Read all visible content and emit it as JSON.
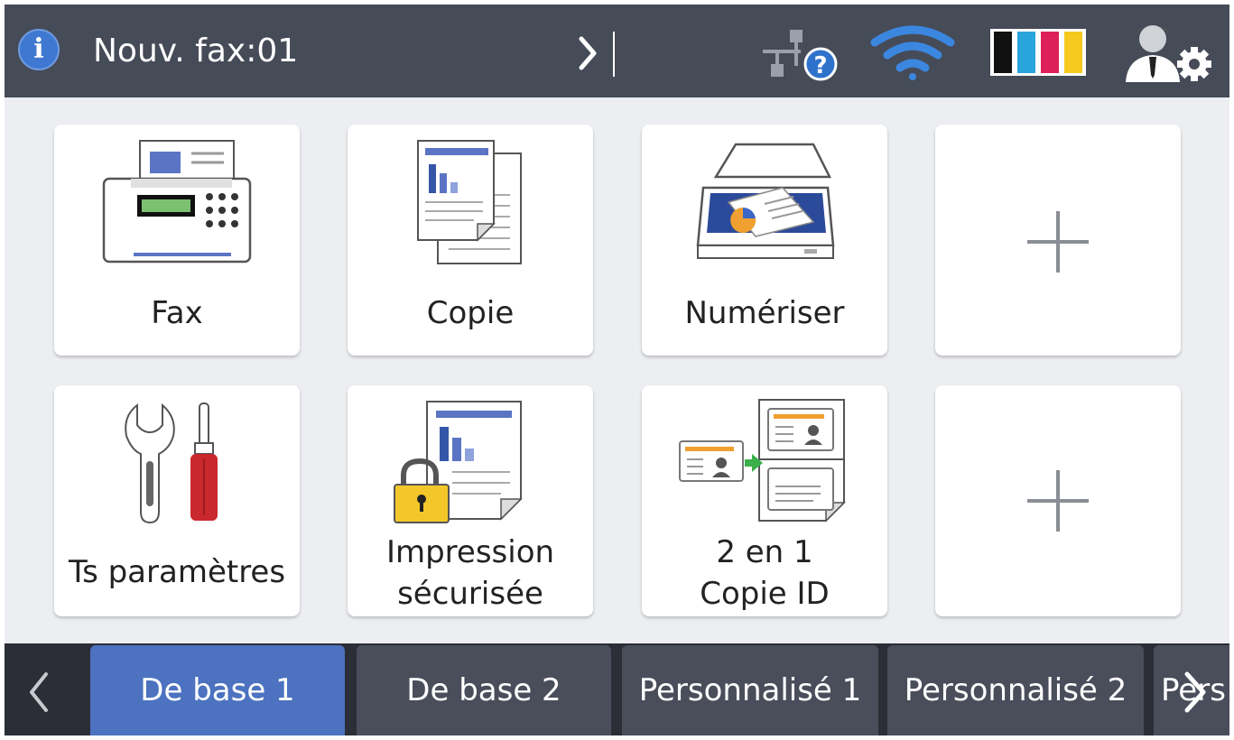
{
  "status_bar": {
    "info_icon": "info-icon",
    "info_glyph": "i",
    "message": "Nouv. fax:01",
    "message_arrow_icon": "chevron-right-icon",
    "network_icon": "wired-network-unknown-icon",
    "wifi_icon": "wifi-icon",
    "ink_icon": "ink-levels-icon",
    "admin_icon": "admin-settings-icon",
    "ink_colors": [
      "#111111",
      "#2aa5dc",
      "#dd1f5a",
      "#f6c91e"
    ]
  },
  "grid": {
    "tiles": [
      {
        "label": "Fax",
        "icon": "fax-machine-icon"
      },
      {
        "label": "Copie",
        "icon": "copy-document-icon"
      },
      {
        "label": "Numériser",
        "icon": "scanner-icon"
      },
      {
        "label": "",
        "icon": "plus-icon"
      },
      {
        "label": "Ts paramètres",
        "icon": "tools-icon"
      },
      {
        "label_line1": "Impression",
        "label_line2": "sécurisée",
        "icon": "secure-print-lock-icon"
      },
      {
        "label_line1": "2 en 1",
        "label_line2": "Copie ID",
        "icon": "id-card-copy-icon"
      },
      {
        "label": "",
        "icon": "plus-icon"
      }
    ]
  },
  "tabs": {
    "prev_icon": "chevron-left-icon",
    "next_icon": "chevron-right-icon",
    "items": [
      {
        "label": "De base 1",
        "active": true
      },
      {
        "label": "De base 2",
        "active": false
      },
      {
        "label": "Personnalisé 1",
        "active": false
      },
      {
        "label": "Personnalisé 2",
        "active": false
      },
      {
        "label": "Pers",
        "active": false
      }
    ]
  },
  "colors": {
    "header_bg": "#464b58",
    "screen_bg": "#eceef1",
    "tab_active": "#4c72c0",
    "tab_inactive": "#4a4e5b",
    "tabbar_bg": "#2b2e36"
  }
}
